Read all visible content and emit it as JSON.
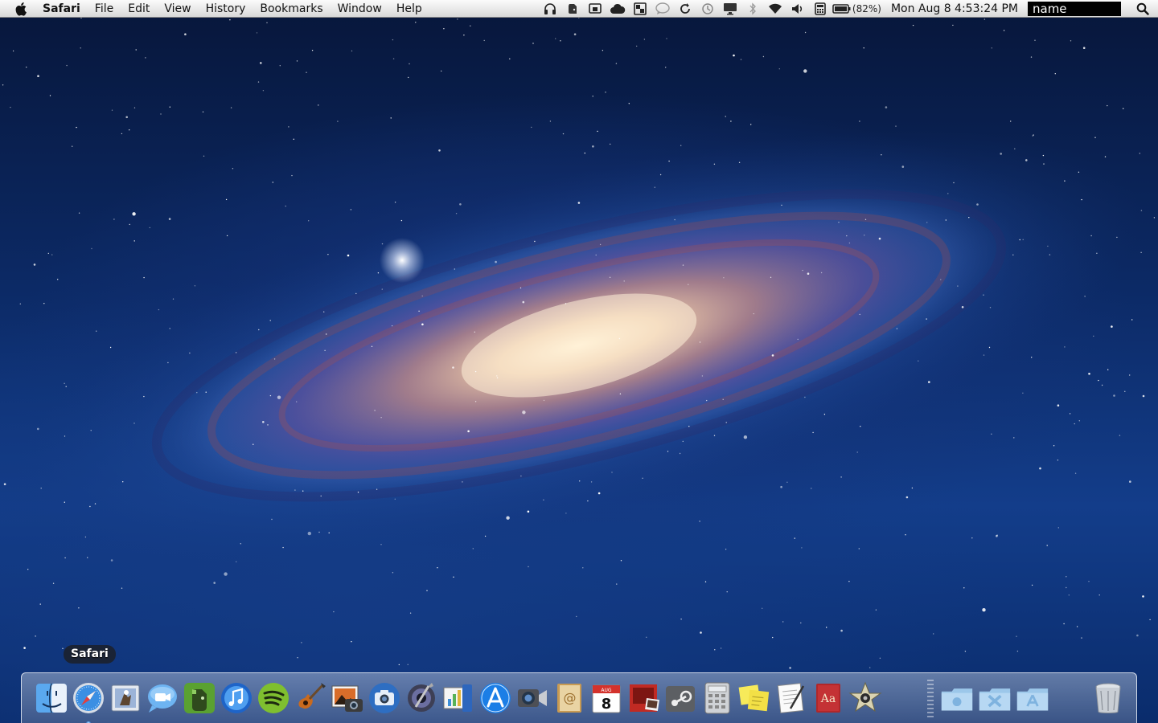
{
  "menubar": {
    "app_name": "Safari",
    "menus": [
      "File",
      "Edit",
      "View",
      "History",
      "Bookmarks",
      "Window",
      "Help"
    ],
    "status_icons": [
      "headphones-icon",
      "evernote-icon",
      "display-icon",
      "cloud-icon",
      "dropbox-icon",
      "messages-icon",
      "sync-icon",
      "time-machine-icon",
      "airplay-display-icon",
      "bluetooth-icon",
      "wifi-icon",
      "volume-icon",
      "calculator-icon",
      "battery-icon"
    ],
    "battery_percent": "(82%)",
    "clock": "Mon Aug 8  4:53:24 PM",
    "user_name": "name"
  },
  "dock": {
    "tooltip": "Safari",
    "apps": [
      "finder-icon",
      "safari-icon",
      "mail-icon",
      "ichat-icon",
      "evernote-icon",
      "itunes-icon",
      "spotify-icon",
      "garageband-icon",
      "iphoto-icon",
      "photo-booth-icon",
      "aperture-icon",
      "keynote-icon",
      "app-store-icon",
      "facetime-icon",
      "address-book-icon",
      "ical-icon",
      "photo-viewer-icon",
      "steam-icon",
      "calculator-icon",
      "stickies-icon",
      "textedit-icon",
      "dictionary-icon",
      "imovie-icon"
    ],
    "ical_day": "8",
    "ical_month": "AUG",
    "stacks": [
      "documents-stack",
      "utilities-stack",
      "applications-stack"
    ],
    "trash": "trash-icon"
  }
}
